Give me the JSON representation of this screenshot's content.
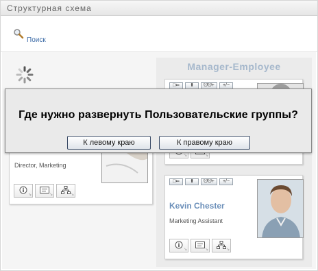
{
  "window": {
    "title": "Структурная схема"
  },
  "toolbar": {
    "search_label": "Поиск",
    "search_icon": "magnifier-icon"
  },
  "zone": {
    "title": "Manager-Employee"
  },
  "cards": {
    "left": {
      "title": "Director, Marketing"
    },
    "right_top": {
      "nav": [
        "□⇐",
        "⬆",
        "ᗢᗢ+",
        "+/−"
      ]
    },
    "right_bottom": {
      "nav": [
        "□⇐",
        "⬆",
        "ᗢᗢ+",
        "+/−"
      ],
      "name": "Kevin Chester",
      "title": "Marketing Assistant"
    }
  },
  "actions": {
    "info_icon": "info-icon",
    "card_icon": "id-card-icon",
    "org_icon": "org-chart-icon"
  },
  "dialog": {
    "question": "Где нужно развернуть Пользовательские группы?",
    "left_button": "К левому краю",
    "right_button": "К правому краю"
  },
  "colors": {
    "accent_link": "#3b6aa6",
    "name_color": "#6b8fb9",
    "zone_title": "#a6b8cc",
    "dialog_bg": "#eaeaea"
  }
}
